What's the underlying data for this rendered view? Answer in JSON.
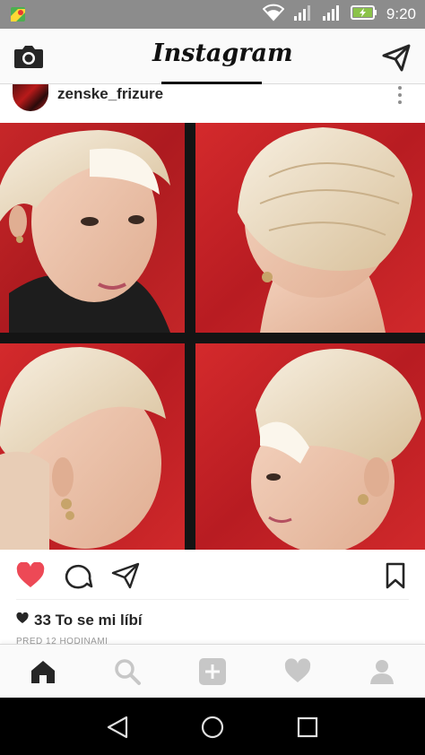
{
  "status_bar": {
    "time": "9:20",
    "icons": [
      "maps-notification-icon",
      "wifi-icon",
      "signal-icon",
      "signal-icon-2",
      "battery-charging-icon"
    ]
  },
  "header": {
    "title": "Instagram",
    "left_icon": "camera-icon",
    "right_icon": "direct-message-icon"
  },
  "post": {
    "username": "zenske_frizure",
    "more_icon": "more-options-icon",
    "image_alt": "",
    "actions": [
      "heart-filled-icon",
      "comment-icon",
      "share-icon",
      "bookmark-icon"
    ],
    "liked": true,
    "likes_text": "33 To se mi líbí",
    "timestamp": "PŘED 12 HODINAMI"
  },
  "tab_bar": {
    "tabs": [
      "home-icon",
      "search-icon",
      "add-post-icon",
      "activity-heart-icon",
      "profile-icon"
    ],
    "active": "home-icon"
  },
  "nav_bar": {
    "buttons": [
      "back-icon",
      "home-circle-icon",
      "recents-icon"
    ]
  },
  "colors": {
    "status_bar": "#8c8c8c",
    "like_red": "#ed4956",
    "backdrop_red": "#c41e24",
    "hair_blonde": "#ecdcc0"
  }
}
